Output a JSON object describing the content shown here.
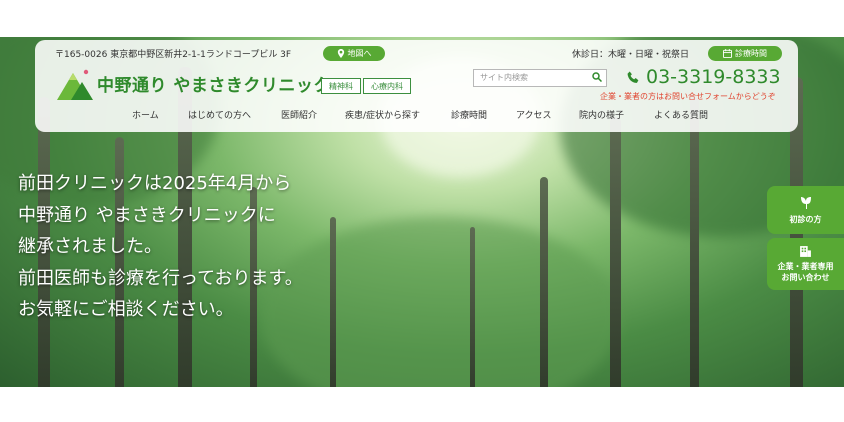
{
  "header": {
    "address": "〒165-0026 東京都中野区新井2-1-1ランドコープビル 3F",
    "map_button": "地図へ",
    "clinic_name": "中野通り やまさきクリニック",
    "badges": [
      "精神科",
      "心療内科"
    ],
    "closed_days": "休診日：木曜・日曜・祝祭日",
    "hours_button": "診療時間",
    "search_placeholder": "サイト内検索",
    "phone": "03-3319-8333",
    "notice": "企業・業者の方はお問い合せフォームからどうぞ"
  },
  "nav": {
    "items": [
      "ホーム",
      "はじめての方へ",
      "医師紹介",
      "疾患/症状から探す",
      "診療時間",
      "アクセス",
      "院内の様子",
      "よくある質問"
    ]
  },
  "hero": {
    "lines": [
      "前田クリニックは2025年4月から",
      "中野通り やまさきクリニックに",
      "継承されました。",
      "前田医師も診療を行っております。",
      "お気軽にご相談ください。"
    ]
  },
  "side": {
    "first_visit": "初診の方",
    "corporate_line1": "企業・業者専用",
    "corporate_line2": "お問い合わせ"
  },
  "colors": {
    "brand_green": "#58a934",
    "text_green": "#2f8a2c",
    "notice_red": "#e0442f"
  },
  "icons": [
    "map-pin-icon",
    "calendar-icon",
    "search-icon",
    "phone-icon",
    "leaf-icon",
    "building-icon",
    "logo-mountain-icon"
  ]
}
